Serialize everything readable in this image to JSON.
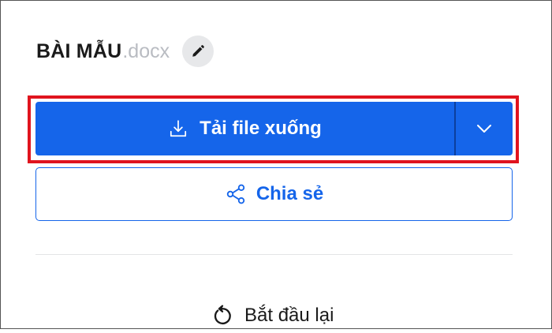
{
  "file": {
    "name": "BÀI MẪU",
    "extension": ".docx",
    "edit_icon": "pencil-icon"
  },
  "download": {
    "label": "Tải file xuống",
    "icon": "download-icon",
    "dropdown_icon": "chevron-down-icon"
  },
  "share": {
    "label": "Chia sẻ",
    "icon": "share-icon"
  },
  "restart": {
    "label": "Bắt đầu lại",
    "icon": "restart-icon"
  },
  "colors": {
    "primary": "#1565ea",
    "highlight": "#e0141e",
    "extension_text": "#b9bcc2"
  }
}
